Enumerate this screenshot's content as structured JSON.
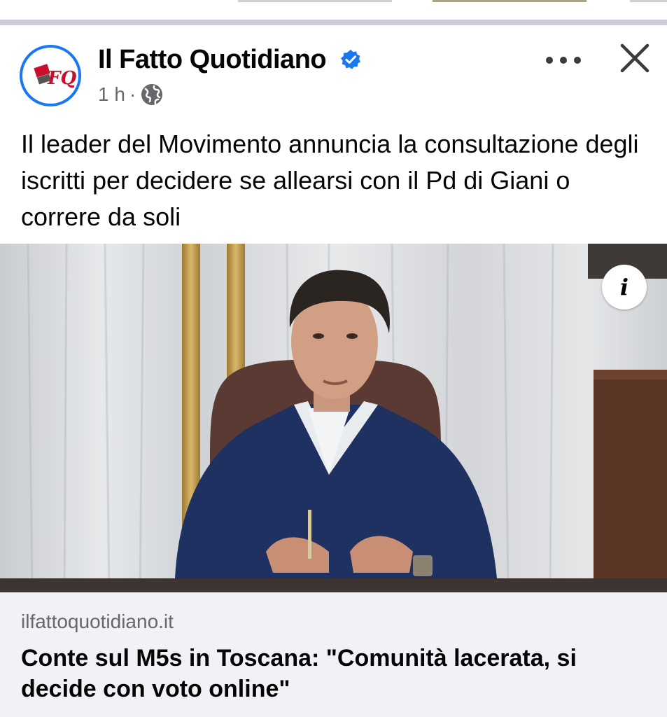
{
  "post": {
    "page_name": "Il Fatto Quotidiano",
    "avatar_text": "FQ",
    "time": "1 h",
    "separator": "·",
    "audience_icon": "globe-icon",
    "more_icon": "more-options-icon",
    "close_icon": "close-icon",
    "verified_icon": "verified-badge-icon",
    "text": "Il leader del Movimento annuncia la consultazione degli iscritti per decidere se allearsi con il Pd di Giani o correre da soli"
  },
  "link_preview": {
    "domain": "ilfattoquotidiano.it",
    "title": "Conte sul M5s in Toscana: \"Comunità lacerata, si decide con voto online\"",
    "info_icon": "info-icon",
    "info_label": "i"
  },
  "colors": {
    "accent": "#1877f2",
    "secondary_text": "#65676b",
    "link_background": "#f0f2f5"
  }
}
